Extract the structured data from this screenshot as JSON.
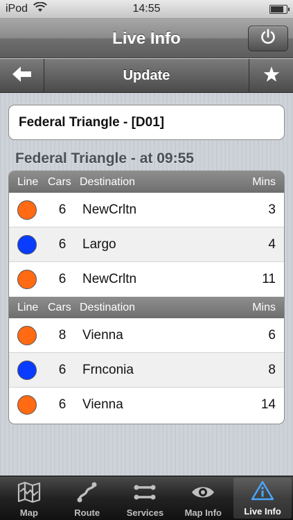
{
  "status_bar": {
    "carrier": "iPod",
    "time": "14:55",
    "battery_level": 0.85
  },
  "nav": {
    "title": "Live Info",
    "right_icon": "power-icon"
  },
  "toolbar": {
    "back_icon": "back-arrow-icon",
    "update_label": "Update",
    "favorite_icon": "star-icon"
  },
  "station": {
    "name": "Federal Triangle - [D01]"
  },
  "section_title": "Federal Triangle - at 09:55",
  "columns": {
    "line": "Line",
    "cars": "Cars",
    "destination": "Destination",
    "mins": "Mins"
  },
  "colors": {
    "orange_line": "#ff6a13",
    "blue_line": "#0a3cff"
  },
  "groups": [
    {
      "rows": [
        {
          "line_color": "#ff6a13",
          "cars": "6",
          "destination": "NewCrltn",
          "mins": "3"
        },
        {
          "line_color": "#0a3cff",
          "cars": "6",
          "destination": "Largo",
          "mins": "4"
        },
        {
          "line_color": "#ff6a13",
          "cars": "6",
          "destination": "NewCrltn",
          "mins": "11"
        }
      ]
    },
    {
      "rows": [
        {
          "line_color": "#ff6a13",
          "cars": "8",
          "destination": "Vienna",
          "mins": "6"
        },
        {
          "line_color": "#0a3cff",
          "cars": "6",
          "destination": "Frnconia",
          "mins": "8"
        },
        {
          "line_color": "#ff6a13",
          "cars": "6",
          "destination": "Vienna",
          "mins": "14"
        }
      ]
    }
  ],
  "tabs": [
    {
      "label": "Map",
      "icon": "map-icon"
    },
    {
      "label": "Route",
      "icon": "route-icon"
    },
    {
      "label": "Services",
      "icon": "services-icon"
    },
    {
      "label": "Map Info",
      "icon": "eye-icon"
    },
    {
      "label": "Live Info",
      "icon": "info-icon",
      "active": true
    }
  ]
}
